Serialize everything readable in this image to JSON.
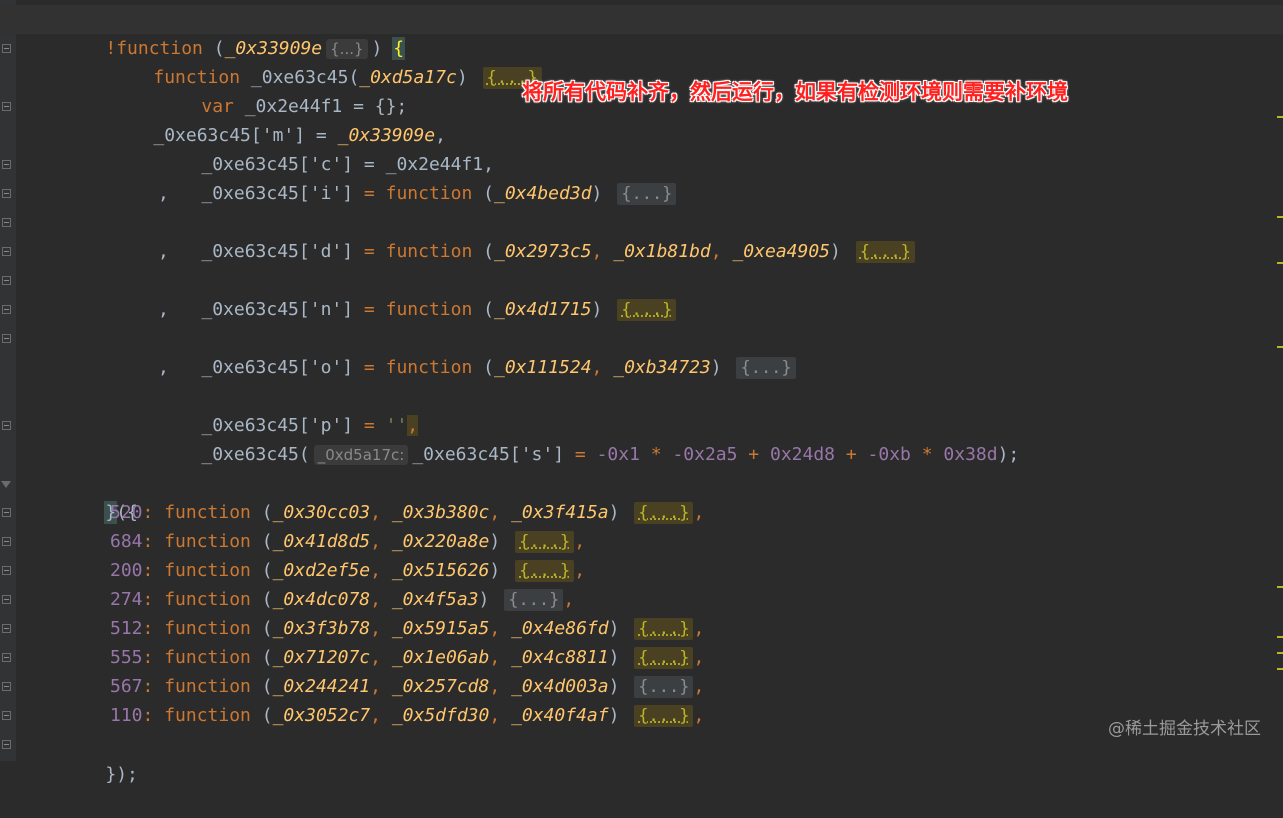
{
  "annotation": "将所有代码补齐，然后运行，如果有检测环境则需要补环境",
  "watermark": "@稀土掘金技术社区",
  "fold_placeholder": "{...}",
  "l1": {
    "kw": "!function",
    "open": " (",
    "param": "_0x33909e",
    "hint": "{...}",
    "close": ") ",
    "brace": "{"
  },
  "l2": {
    "kw": "function",
    "name": " _0xe63c45",
    "open": "(",
    "param": "_0xd5a17c",
    "close": ") "
  },
  "l3": {
    "kw": "var",
    "rest": " _0x2e44f1 = {};"
  },
  "l4": {
    "obj": "_0xe63c45",
    "key": "['m']",
    "eq": " = ",
    "val": "_0x33909e",
    "tail": ","
  },
  "l5": {
    "obj": "_0xe63c45",
    "key": "['c']",
    "eq": " = ",
    "val": "_0x2e44f1,",
    "tail": ""
  },
  "l6": {
    "obj": "_0xe63c45",
    "key": "['i']",
    "eq": " = ",
    "fnkw": "function",
    "open": " (",
    "params": "_0x4bed3d",
    "close": ") "
  },
  "l8": {
    "obj": "_0xe63c45",
    "key": "['d']",
    "eq": " = ",
    "fnkw": "function",
    "open": " (",
    "p1": "_0x2973c5",
    "p2": "_0x1b81bd",
    "p3": "_0xea4905",
    "close": ") "
  },
  "l10": {
    "obj": "_0xe63c45",
    "key": "['n']",
    "eq": " = ",
    "fnkw": "function",
    "open": " (",
    "params": "_0x4d1715",
    "close": ") "
  },
  "l12": {
    "obj": "_0xe63c45",
    "key": "['o']",
    "eq": " = ",
    "fnkw": "function",
    "open": " (",
    "p1": "_0x111524",
    "p2": "_0xb34723",
    "close": ") "
  },
  "l14": {
    "obj": "_0xe63c45",
    "key": "['p']",
    "eq": " = ",
    "str": "''",
    "tail": ","
  },
  "l15": {
    "obj": "_0xe63c45(",
    "hint": "_0xd5a17c:",
    "obj2": "_0xe63c45",
    "key": "['s']",
    "eq": " = ",
    "expr_a": "-0x1",
    "op1": " * ",
    "expr_b": "-0x2a5",
    "op2": " + ",
    "expr_c": "0x24d8",
    "op3": " + ",
    "expr_d": "-0xb",
    "op4": " * ",
    "expr_e": "0x38d",
    "end": ");"
  },
  "comma": ",",
  "l17": {
    "brace": "}",
    "rest": "({"
  },
  "modules": [
    {
      "id": "520",
      "params": [
        "_0x30cc03",
        "_0x3b380c",
        "_0x3f415a"
      ]
    },
    {
      "id": "684",
      "params": [
        "_0x41d8d5",
        "_0x220a8e"
      ]
    },
    {
      "id": "200",
      "params": [
        "_0xd2ef5e",
        "_0x515626"
      ]
    },
    {
      "id": "274",
      "params": [
        "_0x4dc078",
        "_0x4f5a3"
      ]
    },
    {
      "id": "512",
      "params": [
        "_0x3f3b78",
        "_0x5915a5",
        "_0x4e86fd"
      ]
    },
    {
      "id": "555",
      "params": [
        "_0x71207c",
        "_0x1e06ab",
        "_0x4c8811"
      ]
    },
    {
      "id": "567",
      "params": [
        "_0x244241",
        "_0x257cd8",
        "_0x4d003a"
      ]
    },
    {
      "id": "110",
      "params": [
        "_0x3052c7",
        "_0x5dfd30",
        "_0x40f4af"
      ]
    }
  ],
  "module_fn": "function",
  "last": "});"
}
